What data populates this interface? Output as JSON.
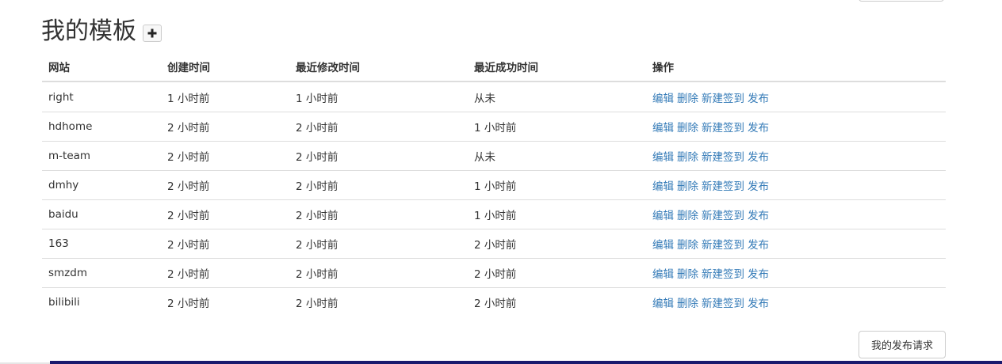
{
  "header": {
    "title": "我的模板"
  },
  "icons": {
    "add": "plus-icon"
  },
  "table": {
    "columns": [
      "网站",
      "创建时间",
      "最近修改时间",
      "最近成功时间",
      "操作"
    ],
    "action_labels": [
      "编辑",
      "删除",
      "新建签到",
      "发布"
    ],
    "rows": [
      {
        "site": "right",
        "created": "1 小时前",
        "modified": "1 小时前",
        "success": "从未"
      },
      {
        "site": "hdhome",
        "created": "2 小时前",
        "modified": "2 小时前",
        "success": "1 小时前"
      },
      {
        "site": "m-team",
        "created": "2 小时前",
        "modified": "2 小时前",
        "success": "从未"
      },
      {
        "site": "dmhy",
        "created": "2 小时前",
        "modified": "2 小时前",
        "success": "1 小时前"
      },
      {
        "site": "baidu",
        "created": "2 小时前",
        "modified": "2 小时前",
        "success": "1 小时前"
      },
      {
        "site": "163",
        "created": "2 小时前",
        "modified": "2 小时前",
        "success": "2 小时前"
      },
      {
        "site": "smzdm",
        "created": "2 小时前",
        "modified": "2 小时前",
        "success": "2 小时前"
      },
      {
        "site": "bilibili",
        "created": "2 小时前",
        "modified": "2 小时前",
        "success": "2 小时前"
      }
    ]
  },
  "footer": {
    "publish_requests_label": "我的发布请求"
  },
  "colors": {
    "link": "#337ab7",
    "border": "#dddddd",
    "bottom_bar": "#1a1a6e"
  }
}
